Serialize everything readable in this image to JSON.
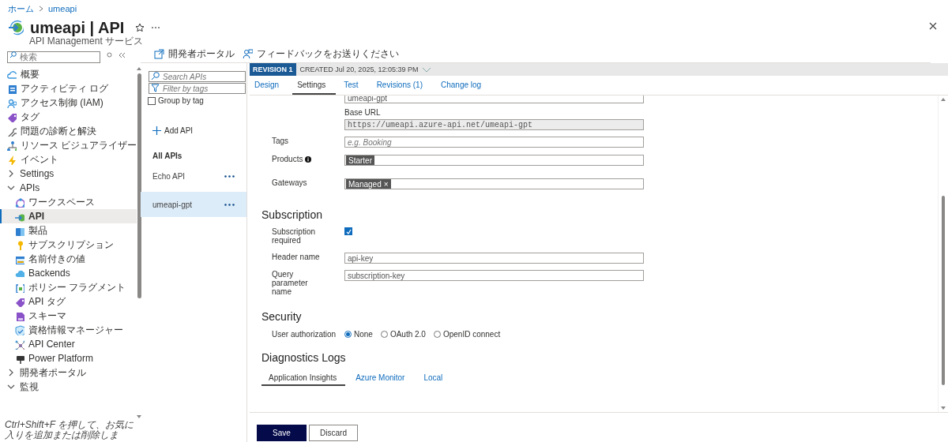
{
  "breadcrumb": [
    {
      "label": "ホーム"
    },
    {
      "label": "umeapi"
    }
  ],
  "header": {
    "title": "umeapi | API",
    "subtitle": "API Management サービス",
    "favorite": false
  },
  "sidebar": {
    "search_placeholder": "検索",
    "items": [
      {
        "label": "概要",
        "selected": false
      },
      {
        "label": "アクティビティ ログ",
        "selected": false
      },
      {
        "label": "アクセス制御 (IAM)",
        "selected": false
      },
      {
        "label": "タグ",
        "selected": false
      },
      {
        "label": "問題の診断と解決",
        "selected": false
      },
      {
        "label": "リソース ビジュアライザー",
        "selected": false
      },
      {
        "label": "イベント",
        "selected": false
      },
      {
        "label": "Settings",
        "selected": false,
        "expanded": false
      },
      {
        "label": "APIs",
        "selected": false,
        "expanded": true,
        "children": [
          {
            "label": "ワークスペース",
            "selected": false
          },
          {
            "label": "API",
            "selected": true
          },
          {
            "label": "製品",
            "selected": false
          },
          {
            "label": "サブスクリプション",
            "selected": false
          },
          {
            "label": "名前付きの値",
            "selected": false
          },
          {
            "label": "Backends",
            "selected": false
          },
          {
            "label": "ポリシー フラグメント",
            "selected": false
          },
          {
            "label": "API タグ",
            "selected": false
          },
          {
            "label": "スキーマ",
            "selected": false
          },
          {
            "label": "資格情報マネージャー",
            "selected": false
          },
          {
            "label": "API Center",
            "selected": false
          },
          {
            "label": "Power Platform",
            "selected": false
          }
        ]
      },
      {
        "label": "開発者ポータル",
        "selected": false,
        "expanded": false
      },
      {
        "label": "監視",
        "selected": false,
        "expanded": true
      }
    ],
    "footer": "Ctrl+Shift+F を押して、お気に入りを追加または削除しま"
  },
  "toolbar": [
    {
      "label": "開発者ポータル"
    },
    {
      "label": "フィードバックをお送りください"
    }
  ],
  "api_list": {
    "search_placeholder": "Search APIs",
    "filter_placeholder": "Filter by tags",
    "group_by_tag": {
      "label": "Group by tag",
      "checked": false
    },
    "add_label": "Add API",
    "section": "All APIs",
    "apis": [
      {
        "name": "Echo API",
        "selected": false
      },
      {
        "name": "umeapi-gpt",
        "selected": true
      }
    ]
  },
  "revision": {
    "badge": "REVISION 1",
    "created": "CREATED Jul 20, 2025, 12:05:39 PM"
  },
  "tabs": [
    {
      "label": "Design",
      "selected": false
    },
    {
      "label": "Settings",
      "selected": true
    },
    {
      "label": "Test",
      "selected": false
    },
    {
      "label": "Revisions (1)",
      "selected": false
    },
    {
      "label": "Change log",
      "selected": false
    }
  ],
  "form": {
    "url_suffix_value": "umeapi-gpt",
    "base_url_label": "Base URL",
    "base_url": "https://umeapi.azure-api.net/umeapi-gpt",
    "tags": {
      "label": "Tags",
      "placeholder": "e.g. Booking"
    },
    "products": {
      "label": "Products",
      "info": true,
      "chips": [
        {
          "label": "Starter"
        }
      ]
    },
    "gateways": {
      "label": "Gateways",
      "chips": [
        {
          "label": "Managed",
          "remove": "×"
        }
      ]
    }
  },
  "subscription": {
    "heading": "Subscription",
    "required": {
      "label": "Subscription required",
      "checked": true
    },
    "header_name": {
      "label": "Header name",
      "value": "api-key"
    },
    "query_param": {
      "label": "Query parameter name",
      "value": "subscription-key"
    }
  },
  "security": {
    "heading": "Security",
    "label": "User authorization",
    "options": [
      {
        "label": "None",
        "selected": true
      },
      {
        "label": "OAuth 2.0",
        "selected": false
      },
      {
        "label": "OpenID connect",
        "selected": false
      }
    ]
  },
  "diagnostics": {
    "heading": "Diagnostics Logs",
    "tabs": [
      {
        "label": "Application Insights",
        "selected": true
      },
      {
        "label": "Azure Monitor",
        "selected": false
      },
      {
        "label": "Local",
        "selected": false
      }
    ]
  },
  "buttons": [
    {
      "label": "Save",
      "kind": "primary"
    },
    {
      "label": "Discard",
      "kind": "secondary"
    }
  ]
}
